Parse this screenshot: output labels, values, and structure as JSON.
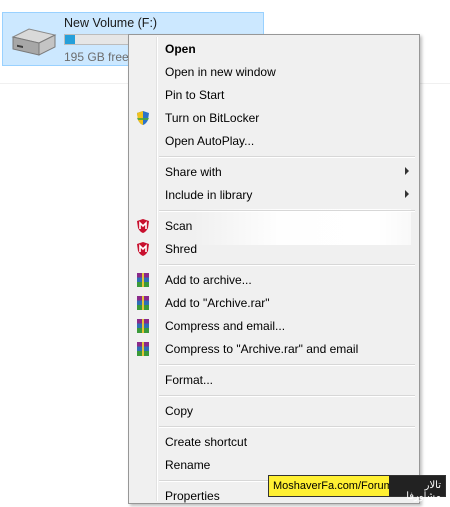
{
  "drive": {
    "name": "New Volume (F:)",
    "free": "195 GB free",
    "used_fraction": 0.05,
    "icon": "hard-drive-icon"
  },
  "menu": {
    "groups": [
      [
        {
          "label": "Open",
          "bold": true
        },
        {
          "label": "Open in new window"
        },
        {
          "label": "Pin to Start"
        },
        {
          "label": "Turn on BitLocker",
          "icon": "shield-icon"
        },
        {
          "label": "Open AutoPlay..."
        }
      ],
      [
        {
          "label": "Share with",
          "submenu": true
        },
        {
          "label": "Include in library",
          "submenu": true
        }
      ],
      [
        {
          "label": "Scan",
          "icon": "mcafee-icon"
        },
        {
          "label": "Shred",
          "icon": "mcafee-icon"
        }
      ],
      [
        {
          "label": "Add to archive...",
          "icon": "winrar-icon"
        },
        {
          "label": "Add to \"Archive.rar\"",
          "icon": "winrar-icon"
        },
        {
          "label": "Compress and email...",
          "icon": "winrar-icon"
        },
        {
          "label": "Compress to \"Archive.rar\" and email",
          "icon": "winrar-icon"
        }
      ],
      [
        {
          "label": "Format..."
        }
      ],
      [
        {
          "label": "Copy"
        }
      ],
      [
        {
          "label": "Create shortcut"
        },
        {
          "label": "Rename"
        }
      ],
      [
        {
          "label": "Properties"
        }
      ]
    ]
  },
  "watermark": {
    "left_text": "MoshaverFa.com/Forum",
    "right_text": "تالار مشاورفا"
  },
  "colors": {
    "selection_bg": "#cce8ff",
    "menu_bg": "#f0f0f0",
    "watermark_yellow": "#fff033"
  }
}
